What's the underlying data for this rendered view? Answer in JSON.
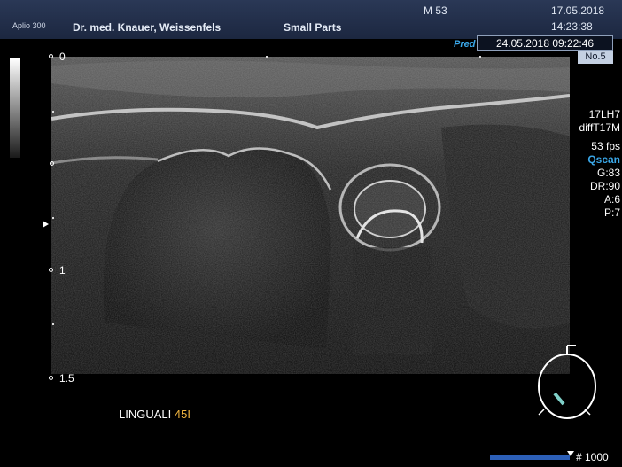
{
  "header": {
    "model": "Aplio 300",
    "institution": "Dr. med. Knauer, Weissenfels",
    "preset": "Small Parts",
    "mode": "M 53",
    "date": "17.05.2018",
    "time": "14:23:38"
  },
  "capture": {
    "pred_label": "Pred",
    "timestamp": "24.05.2018   09:22:46",
    "frame_no": "No.5"
  },
  "depth_scale": {
    "labels": [
      "0",
      "1",
      "1.5"
    ]
  },
  "parameters": {
    "transducer": "17LH7",
    "mode": "diffT17M",
    "fps": "53 fps",
    "qscan": "Qscan",
    "gain": "G:83",
    "dynamic_range": "DR:90",
    "a": "A:6",
    "p": "P:7"
  },
  "annotation": {
    "text": "LINGUALI",
    "tooth": "45I"
  },
  "footer": {
    "frame_count": "# 1000"
  },
  "colors": {
    "header_bg": "#1c2740",
    "accent_blue": "#3aa7e8",
    "tooth_label": "#f2b640",
    "frame_bar": "#2c5fb7",
    "probe_marker": "#7fd0c8"
  },
  "icons": [
    "grayscale-bar",
    "focus-marker-icon",
    "body-marker-icon"
  ]
}
